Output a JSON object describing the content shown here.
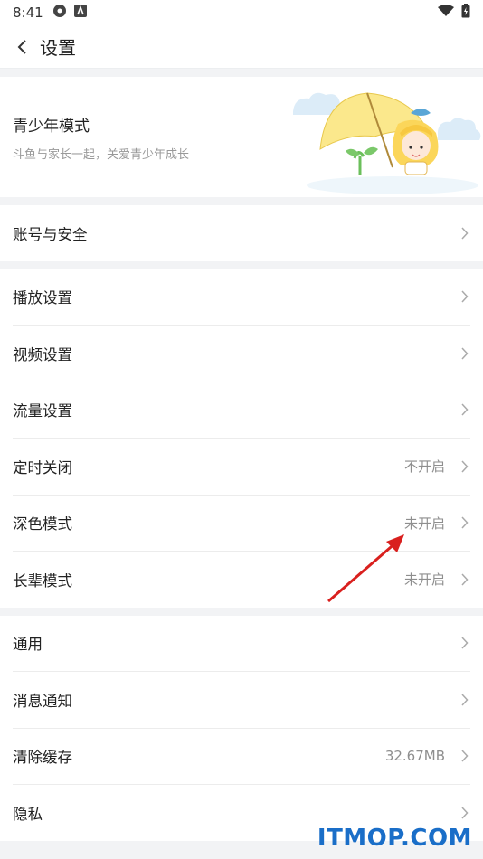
{
  "status_bar": {
    "time": "8:41"
  },
  "header": {
    "title": "设置"
  },
  "teen": {
    "title": "青少年模式",
    "subtitle": "斗鱼与家长一起，关爱青少年成长"
  },
  "account": {
    "label": "账号与安全"
  },
  "group_play": [
    {
      "label": "播放设置",
      "value": ""
    },
    {
      "label": "视频设置",
      "value": ""
    },
    {
      "label": "流量设置",
      "value": ""
    },
    {
      "label": "定时关闭",
      "value": "不开启"
    },
    {
      "label": "深色模式",
      "value": "未开启"
    },
    {
      "label": "长辈模式",
      "value": "未开启"
    }
  ],
  "group_general": [
    {
      "label": "通用",
      "value": ""
    },
    {
      "label": "消息通知",
      "value": ""
    },
    {
      "label": "清除缓存",
      "value": "32.67MB"
    },
    {
      "label": "隐私",
      "value": ""
    }
  ],
  "watermark": "ITMOP.COM",
  "colors": {
    "annotation_arrow": "#d9201e",
    "watermark": "#1a6ec8"
  }
}
